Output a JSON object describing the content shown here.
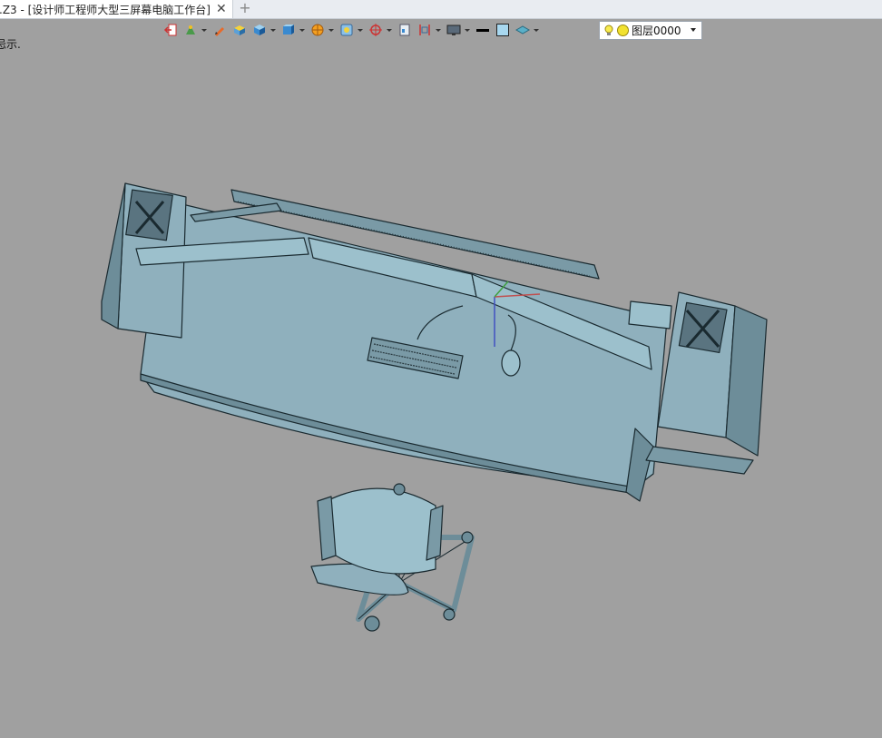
{
  "window": {
    "tab_title": ".Z3 - [设计师工程师大型三屏幕电脑工作台]",
    "tab_close": "✕",
    "tab_add": "+"
  },
  "toolbar": {
    "buttons": [
      "undo-view",
      "shading",
      "draw",
      "solid",
      "cube",
      "view-cube",
      "section",
      "render",
      "zoom",
      "grid",
      "frame",
      "display",
      "line-color",
      "fill-color",
      "layer-visibility"
    ],
    "layer_name": "图层0000"
  },
  "status": {
    "message": "忌示."
  },
  "colors": {
    "background": "#a0a0a0",
    "model_fill": "#8fb0bd",
    "model_dark": "#6d8d99",
    "edge": "#1a2a30",
    "layer_color": "#f2e230"
  }
}
